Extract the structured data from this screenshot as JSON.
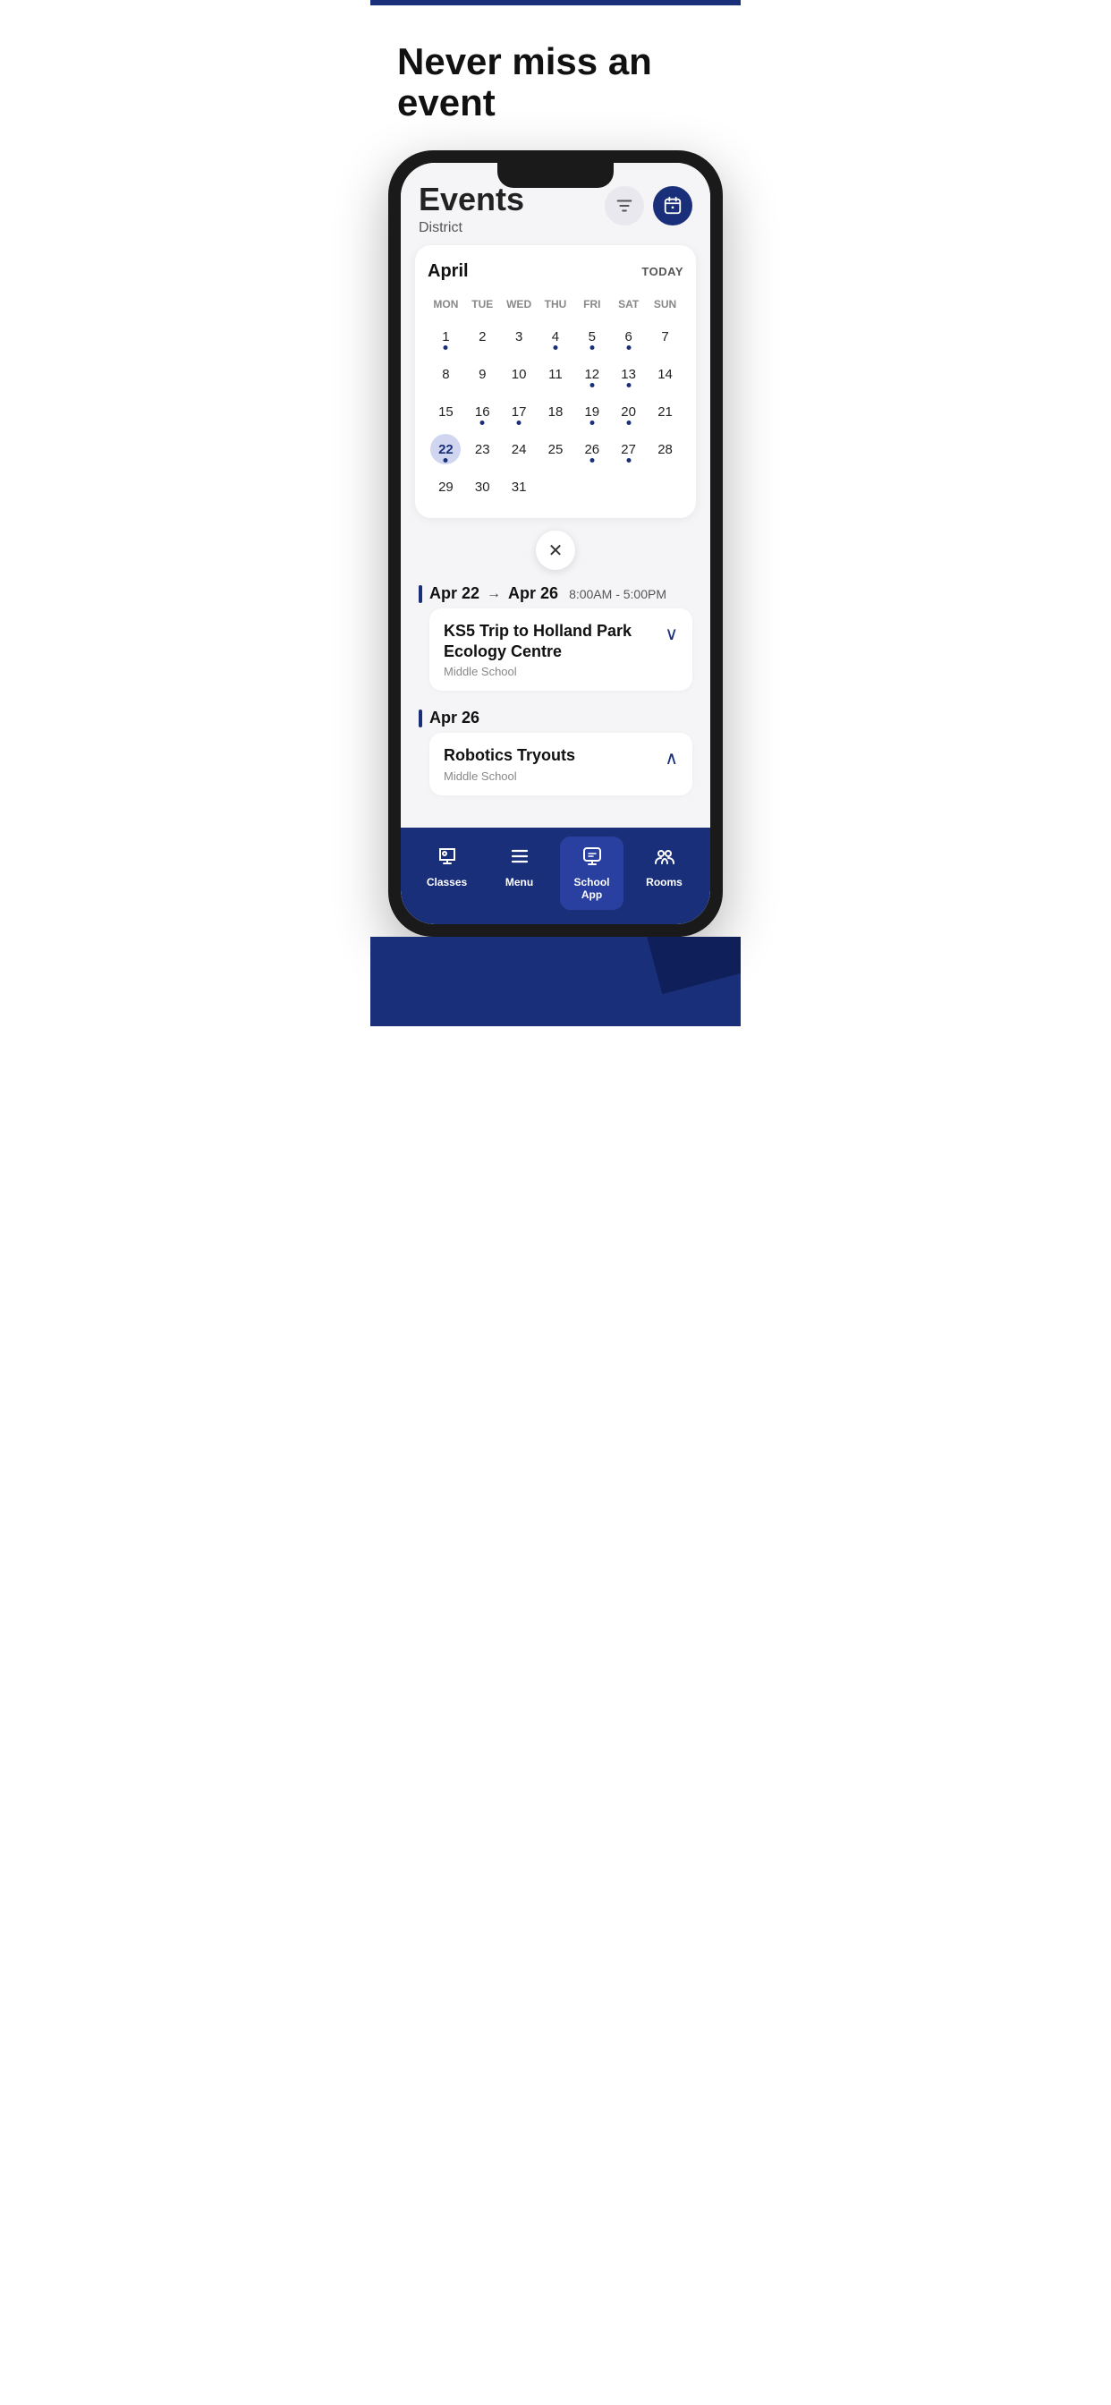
{
  "page": {
    "top_bar_color": "#1a2f7a",
    "headline": "Never miss an event",
    "accent_color": "#1a2f7a"
  },
  "events_screen": {
    "title": "Events",
    "subtitle": "District",
    "filter_button_label": "filter",
    "calendar_button_label": "calendar"
  },
  "calendar": {
    "month": "April",
    "today_btn": "TODAY",
    "days_of_week": [
      "MON",
      "TUE",
      "WED",
      "THU",
      "FRI",
      "SAT",
      "SUN"
    ],
    "weeks": [
      [
        {
          "day": "1",
          "dot": true,
          "today": false
        },
        {
          "day": "2",
          "dot": false,
          "today": false
        },
        {
          "day": "3",
          "dot": false,
          "today": false
        },
        {
          "day": "4",
          "dot": true,
          "today": false
        },
        {
          "day": "5",
          "dot": true,
          "today": false
        },
        {
          "day": "6",
          "dot": true,
          "today": false
        },
        {
          "day": "7",
          "dot": false,
          "today": false
        }
      ],
      [
        {
          "day": "8",
          "dot": false,
          "today": false
        },
        {
          "day": "9",
          "dot": false,
          "today": false
        },
        {
          "day": "10",
          "dot": false,
          "today": false
        },
        {
          "day": "11",
          "dot": false,
          "today": false
        },
        {
          "day": "12",
          "dot": true,
          "today": false
        },
        {
          "day": "13",
          "dot": true,
          "today": false
        },
        {
          "day": "14",
          "dot": false,
          "today": false
        }
      ],
      [
        {
          "day": "15",
          "dot": false,
          "today": false
        },
        {
          "day": "16",
          "dot": true,
          "today": false
        },
        {
          "day": "17",
          "dot": true,
          "today": false
        },
        {
          "day": "18",
          "dot": false,
          "today": false
        },
        {
          "day": "19",
          "dot": true,
          "today": false
        },
        {
          "day": "20",
          "dot": true,
          "today": false
        },
        {
          "day": "21",
          "dot": false,
          "today": false
        }
      ],
      [
        {
          "day": "22",
          "dot": true,
          "today": true
        },
        {
          "day": "23",
          "dot": false,
          "today": false
        },
        {
          "day": "24",
          "dot": false,
          "today": false
        },
        {
          "day": "25",
          "dot": false,
          "today": false
        },
        {
          "day": "26",
          "dot": true,
          "today": false
        },
        {
          "day": "27",
          "dot": true,
          "today": false
        },
        {
          "day": "28",
          "dot": false,
          "today": false
        }
      ],
      [
        {
          "day": "29",
          "dot": false,
          "today": false
        },
        {
          "day": "30",
          "dot": false,
          "today": false
        },
        {
          "day": "31",
          "dot": false,
          "today": false
        },
        {
          "day": "",
          "dot": false,
          "today": false
        },
        {
          "day": "",
          "dot": false,
          "today": false
        },
        {
          "day": "",
          "dot": false,
          "today": false
        },
        {
          "day": "",
          "dot": false,
          "today": false
        }
      ]
    ],
    "close_btn": "×"
  },
  "events": [
    {
      "date_start": "Apr 22",
      "date_end": "Apr 26",
      "time": "8:00AM - 5:00PM",
      "name": "KS5 Trip to Holland Park Ecology Centre",
      "location": "Middle School",
      "expanded": false
    },
    {
      "date_start": "Apr 26",
      "date_end": "",
      "time": "",
      "name": "Robotics Tryouts",
      "location": "Middle School",
      "expanded": true
    }
  ],
  "bottom_nav": [
    {
      "label": "Classes",
      "icon": "🎓",
      "active": false
    },
    {
      "label": "Menu",
      "icon": "☰",
      "active": false
    },
    {
      "label": "School App",
      "icon": "💬",
      "active": true
    },
    {
      "label": "Rooms",
      "icon": "👥",
      "active": false
    }
  ]
}
